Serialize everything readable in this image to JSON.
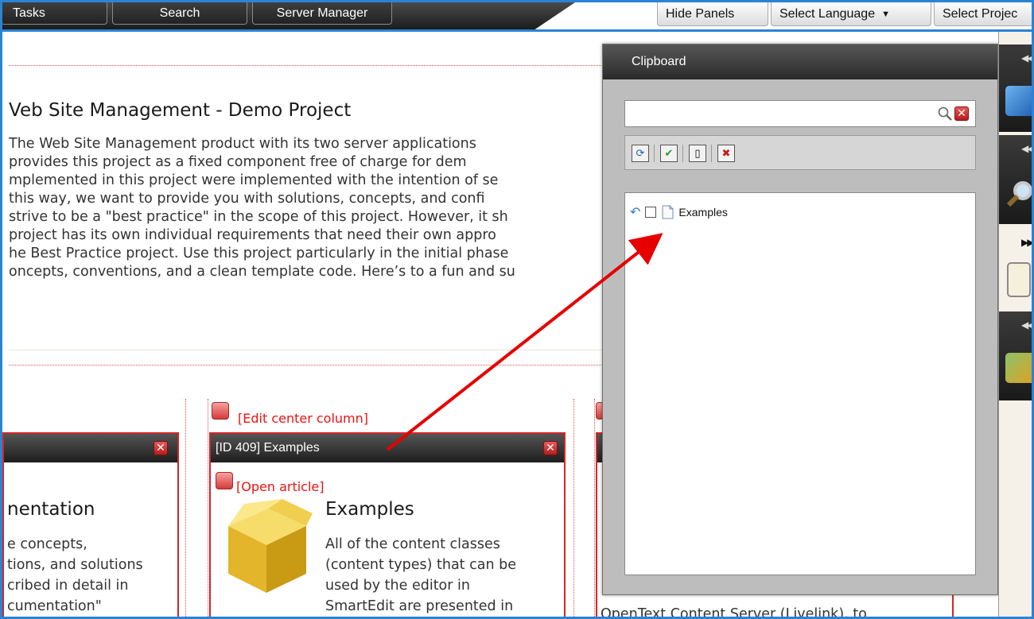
{
  "toolbar": {
    "tasks": "Tasks",
    "search": "Search",
    "server_manager": "Server Manager",
    "hide_panels": "Hide Panels",
    "select_language": "Select Language",
    "select_project": "Select Projec"
  },
  "page": {
    "title": "Veb Site Management - Demo Project",
    "intro_lines": [
      "The Web Site Management product with its two server applications",
      "provides this project as a fixed component free of charge for dem",
      "mplemented in this project were implemented with the intention of se",
      "this way, we want to provide you with solutions, concepts, and confi",
      "strive to be a \"best practice\" in the scope of this project. However, it sh",
      "project has its own individual requirements that need their own appro",
      "he Best Practice project. Use this project particularly in the initial phase",
      "oncepts, conventions, and a clean template code. Here’s to a fun and su"
    ]
  },
  "columns": {
    "left": {
      "title": "nentation",
      "lines": [
        "e concepts,",
        "tions, and solutions",
        "cribed in detail in",
        "cumentation\""
      ]
    },
    "center": {
      "edit_link": "[Edit center column]",
      "header": "[ID 409] Examples",
      "open_link": "[Open article]",
      "title": "Examples",
      "lines": [
        "All of the content classes",
        "(content types) that can be",
        "used by the editor in",
        "SmartEdit are presented in"
      ]
    },
    "right": {
      "bottom_text": "OpenText Content Server (Livelink), to"
    }
  },
  "clipboard": {
    "title": "Clipboard",
    "search_placeholder": "",
    "items": [
      {
        "label": "Examples"
      }
    ]
  },
  "colors": {
    "accent_blue": "#2b83d6",
    "link_red": "#e11111",
    "header_dark": "#2a2a2a",
    "arrow_red": "#e60000"
  }
}
